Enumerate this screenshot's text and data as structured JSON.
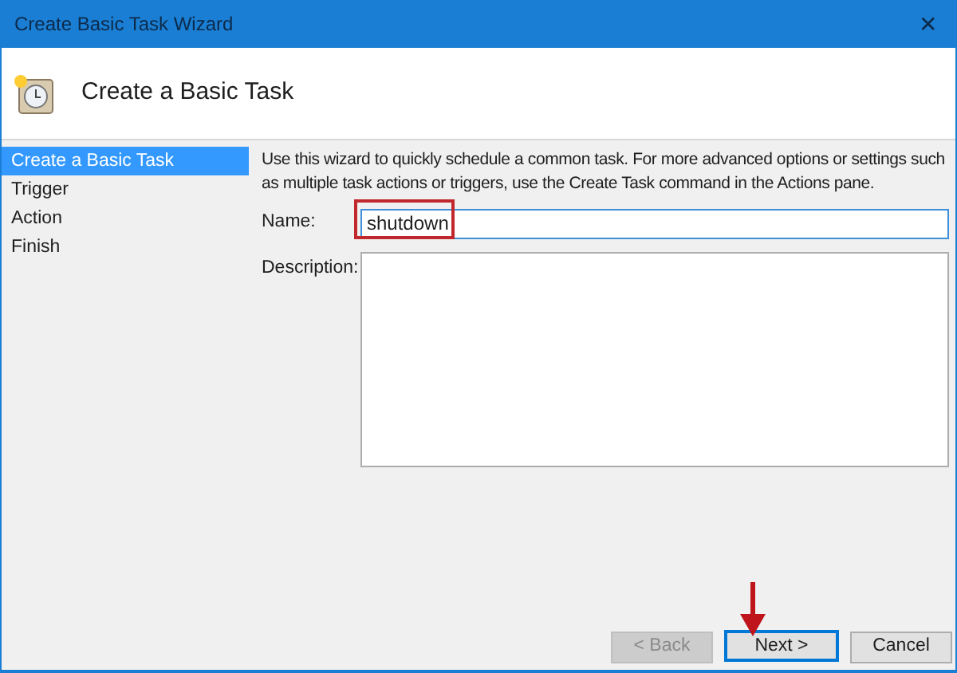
{
  "window": {
    "title": "Create Basic Task Wizard",
    "close": "✕"
  },
  "header": {
    "title": "Create a Basic Task"
  },
  "steps": [
    {
      "label": "Create a Basic Task",
      "selected": true
    },
    {
      "label": "Trigger",
      "selected": false
    },
    {
      "label": "Action",
      "selected": false
    },
    {
      "label": "Finish",
      "selected": false
    }
  ],
  "intro": "Use this wizard to quickly schedule a common task.  For more advanced options or settings such as multiple task actions or triggers, use the Create Task command in the Actions pane.",
  "name_field": {
    "label": "Name:",
    "value": "shutdown",
    "highlighted": true
  },
  "description_field": {
    "label": "Description:"
  },
  "buttons": [
    {
      "label": "< Back",
      "disabled": true,
      "focused": false,
      "pointed": false
    },
    {
      "label": "Next >",
      "disabled": false,
      "focused": true,
      "pointed": true
    },
    {
      "label": "Cancel",
      "disabled": false,
      "focused": false,
      "pointed": false
    }
  ]
}
